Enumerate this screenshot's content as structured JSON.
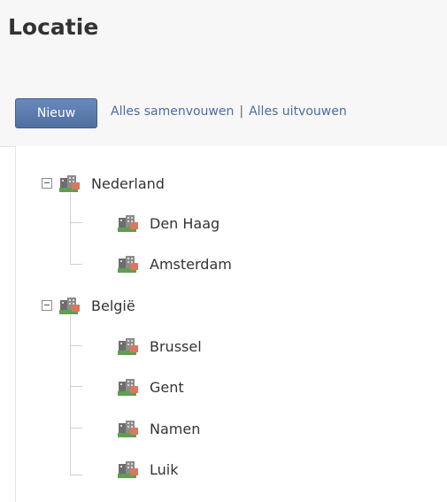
{
  "page": {
    "title": "Locatie"
  },
  "toolbar": {
    "new_label": "Nieuw",
    "collapse_all": "Alles samenvouwen",
    "separator": "|",
    "expand_all": "Alles uitvouwen"
  },
  "tree": {
    "icon": "building-location-icon",
    "toggle_icon": "collapse-icon",
    "groups": [
      {
        "label": "Nederland",
        "children": [
          "Den Haag",
          "Amsterdam"
        ]
      },
      {
        "label": "België",
        "children": [
          "Brussel",
          "Gent",
          "Namen",
          "Luik"
        ]
      }
    ]
  }
}
